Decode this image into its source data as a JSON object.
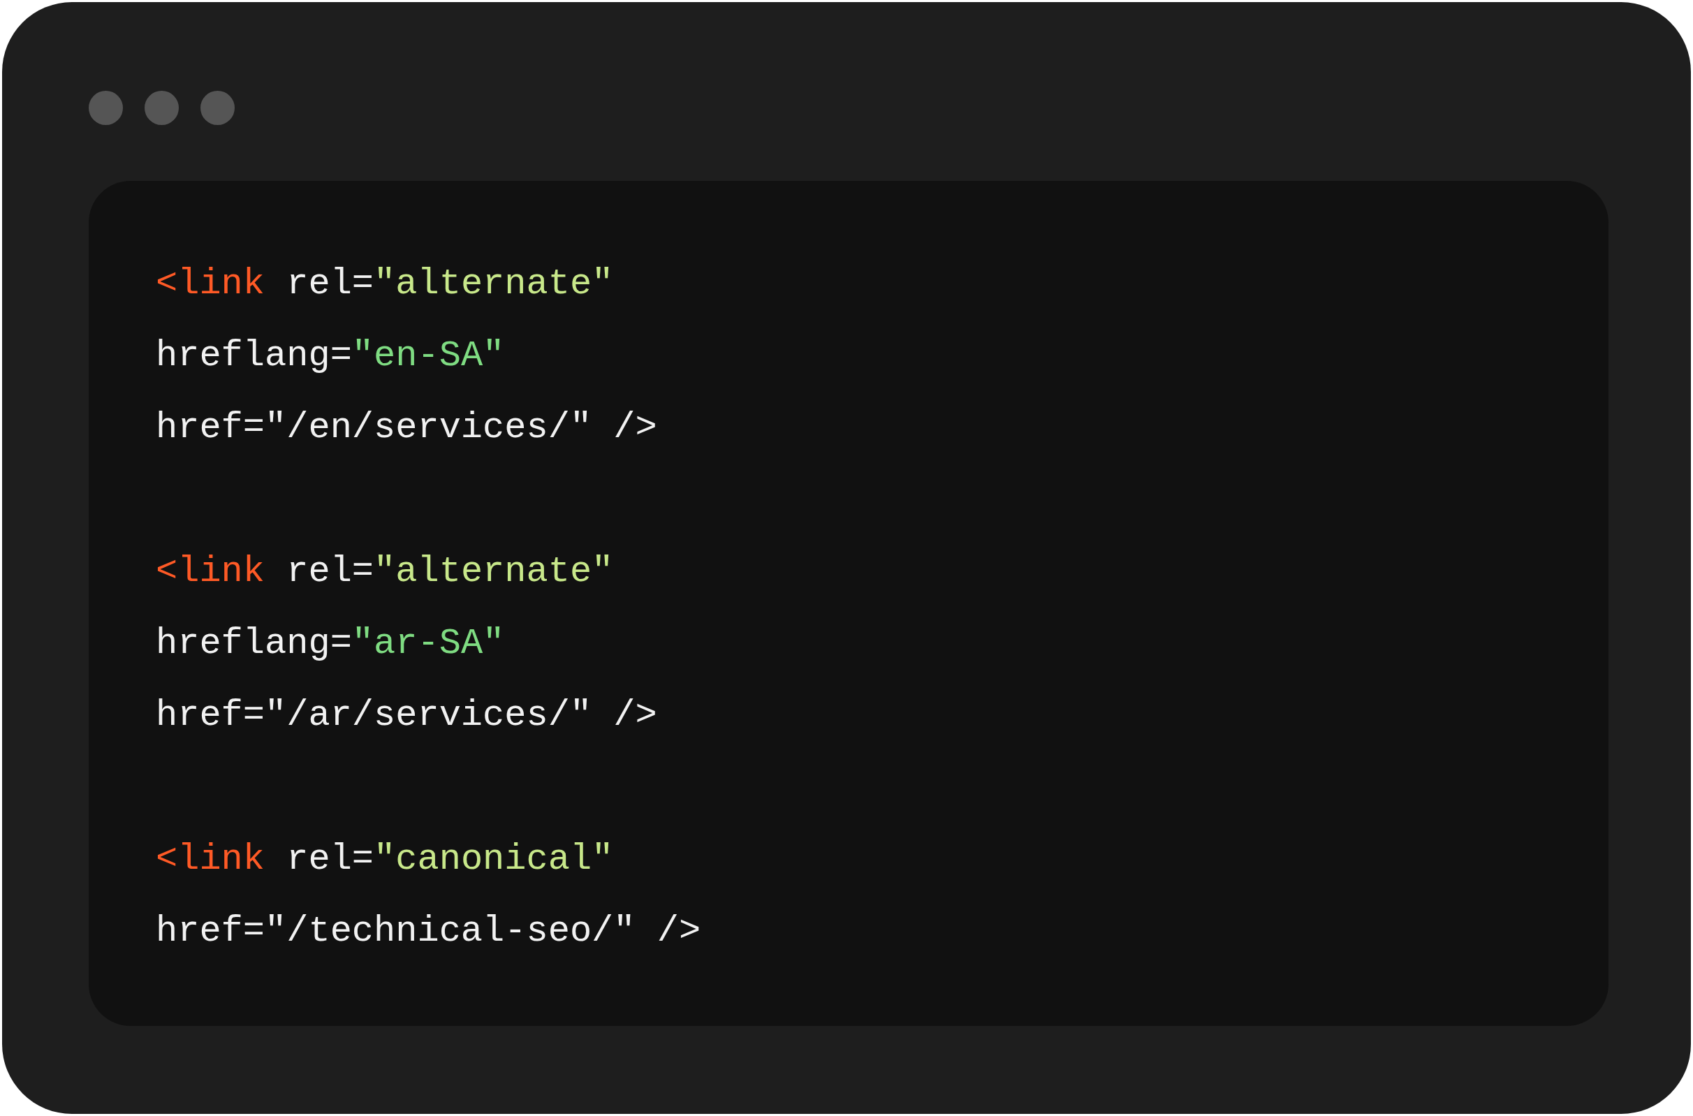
{
  "window": {
    "controls": [
      {
        "kind": "dot"
      },
      {
        "kind": "dot"
      },
      {
        "kind": "dot"
      }
    ]
  },
  "code_blocks": [
    {
      "lines": [
        [
          {
            "kind": "tag",
            "text": "<link"
          },
          {
            "kind": "attr",
            "text": " rel="
          },
          {
            "kind": "value",
            "text": "\"alternate\""
          }
        ],
        [
          {
            "kind": "attr",
            "text": "hreflang="
          },
          {
            "kind": "string",
            "text": "\"en-SA\""
          }
        ],
        [
          {
            "kind": "attr",
            "text": "href=\"/en/services/\" />"
          }
        ]
      ]
    },
    {
      "lines": [
        [
          {
            "kind": "tag",
            "text": "<link"
          },
          {
            "kind": "attr",
            "text": " rel="
          },
          {
            "kind": "value",
            "text": "\"alternate\""
          }
        ],
        [
          {
            "kind": "attr",
            "text": "hreflang="
          },
          {
            "kind": "string",
            "text": "\"ar-SA\""
          }
        ],
        [
          {
            "kind": "attr",
            "text": "href=\"/ar/services/\" />"
          }
        ]
      ]
    },
    {
      "lines": [
        [
          {
            "kind": "tag",
            "text": "<link"
          },
          {
            "kind": "attr",
            "text": " rel="
          },
          {
            "kind": "value",
            "text": "\"canonical\""
          }
        ],
        [
          {
            "kind": "attr",
            "text": "href=\"/technical-seo/\" />"
          }
        ]
      ]
    }
  ]
}
